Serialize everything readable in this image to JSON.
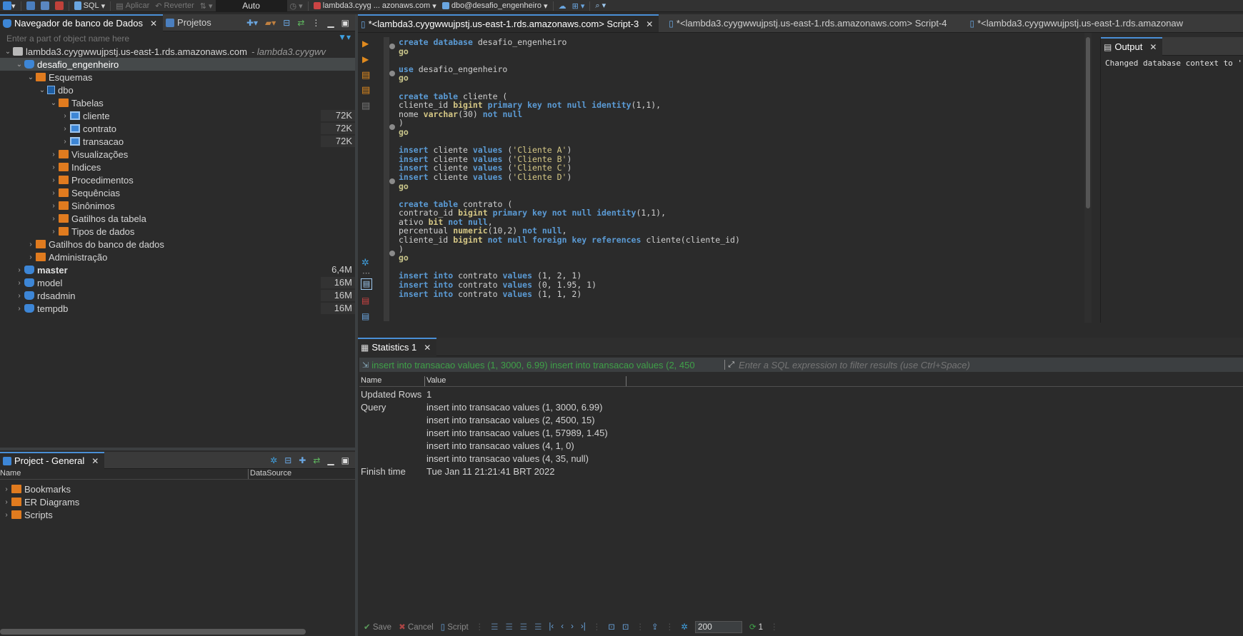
{
  "toolbar": {
    "sql_label": "SQL",
    "apply_label": "Aplicar",
    "revert_label": "Reverter",
    "commit_mode": "Auto",
    "connection": "lambda3.cyyg ... azonaws.com",
    "schema": "dbo@desafio_engenheiro"
  },
  "navigator": {
    "tab_active": "Navegador de banco de Dados",
    "tab_projects": "Projetos",
    "filter_placeholder": "Enter a part of object name here",
    "connection_label": "lambda3.cyygwwujpstj.us-east-1.rds.amazonaws.com",
    "connection_suffix": "- lambda3.cyygwv",
    "tree": [
      {
        "label": "desafio_engenheiro",
        "size": ""
      },
      {
        "label": "Esquemas",
        "size": ""
      },
      {
        "label": "dbo",
        "size": ""
      },
      {
        "label": "Tabelas",
        "size": ""
      },
      {
        "label": "cliente",
        "size": "72K"
      },
      {
        "label": "contrato",
        "size": "72K"
      },
      {
        "label": "transacao",
        "size": "72K"
      },
      {
        "label": "Visualizações",
        "size": ""
      },
      {
        "label": "Indices",
        "size": ""
      },
      {
        "label": "Procedimentos",
        "size": ""
      },
      {
        "label": "Sequências",
        "size": ""
      },
      {
        "label": "Sinônimos",
        "size": ""
      },
      {
        "label": "Gatilhos da tabela",
        "size": ""
      },
      {
        "label": "Tipos de dados",
        "size": ""
      },
      {
        "label": "Gatilhos do banco de dados",
        "size": ""
      },
      {
        "label": "Administração",
        "size": ""
      },
      {
        "label": "master",
        "size": "6,4M"
      },
      {
        "label": "model",
        "size": "16M"
      },
      {
        "label": "rdsadmin",
        "size": "16M"
      },
      {
        "label": "tempdb",
        "size": "16M"
      }
    ]
  },
  "project": {
    "title": "Project - General",
    "col_name": "Name",
    "col_datasource": "DataSource",
    "items": [
      "Bookmarks",
      "ER Diagrams",
      "Scripts"
    ]
  },
  "editor": {
    "tabs": [
      "*<lambda3.cyygwwujpstj.us-east-1.rds.amazonaws.com> Script-3",
      "*<lambda3.cyygwwujpstj.us-east-1.rds.amazonaws.com> Script-4",
      "*<lambda3.cyygwwujpstj.us-east-1.rds.amazonaw"
    ]
  },
  "output": {
    "title": "Output",
    "text": "Changed database context to '"
  },
  "results": {
    "tab": "Statistics 1",
    "filter_query": "insert into transacao values (1, 3000, 6.99)  insert into transacao values (2, 450",
    "filter_placeholder": "Enter a SQL expression to filter results (use Ctrl+Space)",
    "col_name": "Name",
    "col_value": "Value",
    "updated_rows_label": "Updated Rows",
    "updated_rows_value": "1",
    "query_label": "Query",
    "query_lines": [
      "insert into transacao values (1, 3000, 6.99)",
      "insert into transacao values (2, 4500, 15)",
      "insert into transacao values (1, 57989, 1.45)",
      "insert into transacao values (4, 1, 0)",
      "insert into transacao values (4, 35, null)"
    ],
    "finish_label": "Finish time",
    "finish_value": "Tue Jan 11 21:21:41 BRT 2022",
    "save": "Save",
    "cancel": "Cancel",
    "script": "Script",
    "fetch_size": "200",
    "refresh_count": "1"
  }
}
